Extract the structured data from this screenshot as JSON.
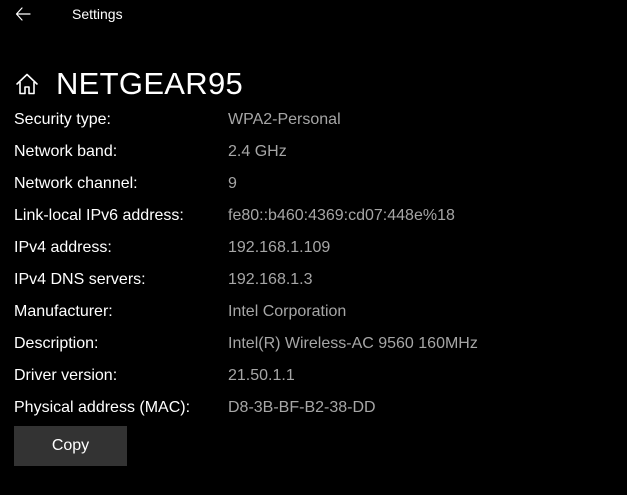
{
  "window": {
    "title": "Settings"
  },
  "header": {
    "icon": "home-icon",
    "network_name": "NETGEAR95"
  },
  "properties": [
    {
      "label": "Security type:",
      "value": "WPA2-Personal"
    },
    {
      "label": "Network band:",
      "value": "2.4 GHz"
    },
    {
      "label": "Network channel:",
      "value": "9"
    },
    {
      "label": "Link-local IPv6 address:",
      "value": "fe80::b460:4369:cd07:448e%18"
    },
    {
      "label": "IPv4 address:",
      "value": "192.168.1.109"
    },
    {
      "label": "IPv4 DNS servers:",
      "value": "192.168.1.3"
    },
    {
      "label": "Manufacturer:",
      "value": "Intel Corporation"
    },
    {
      "label": "Description:",
      "value": "Intel(R) Wireless-AC 9560 160MHz"
    },
    {
      "label": "Driver version:",
      "value": "21.50.1.1"
    },
    {
      "label": "Physical address (MAC):",
      "value": "D8-3B-BF-B2-38-DD"
    }
  ],
  "actions": {
    "copy_label": "Copy"
  },
  "colors": {
    "background": "#000000",
    "label": "#ffffff",
    "value": "#a6a6a6",
    "button": "#333333"
  }
}
